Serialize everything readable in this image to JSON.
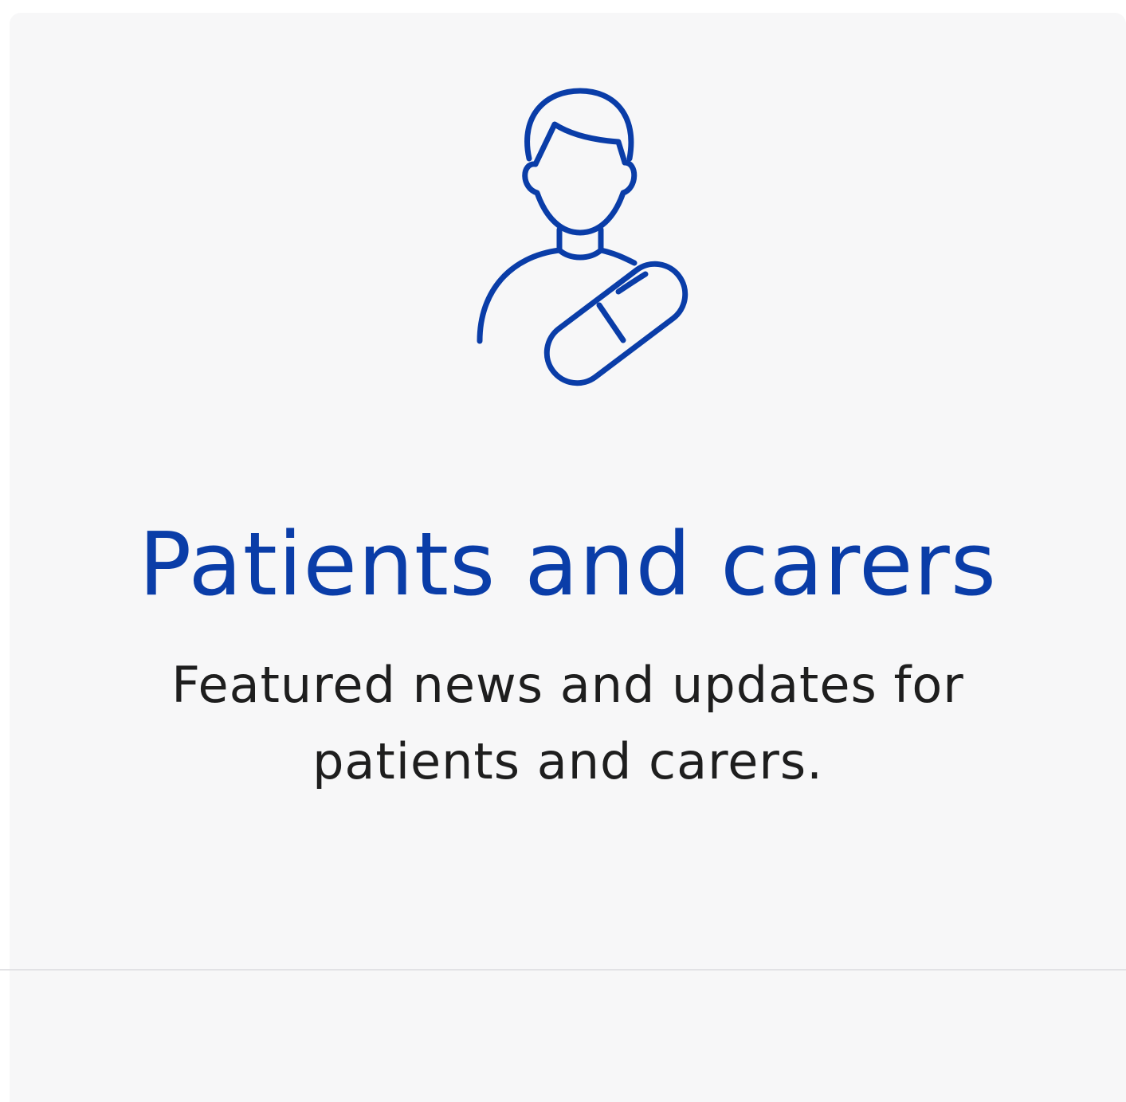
{
  "card": {
    "title": "Patients and carers",
    "description": "Featured news and updates for patients and carers.",
    "icon": "patient-with-pill-icon"
  },
  "colors": {
    "accent": "#0a3da8",
    "text": "#1e1e1e",
    "card_background": "#f7f7f8",
    "divider": "#e2e2e5"
  }
}
